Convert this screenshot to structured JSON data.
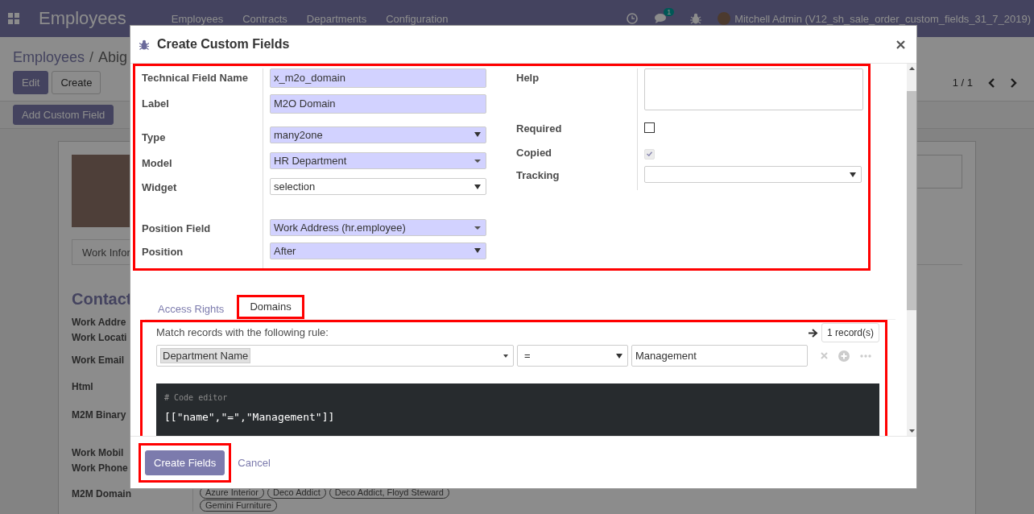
{
  "navbar": {
    "app_title": "Employees",
    "menu": [
      "Employees",
      "Contracts",
      "Departments",
      "Configuration"
    ],
    "chat_count": "1",
    "user": "Mitchell Admin (V12_sh_sale_order_custom_fields_31_7_2019)"
  },
  "control_panel": {
    "breadcrumb": [
      "Employees",
      "Abig"
    ],
    "breadcrumb_separator": "/",
    "buttons": [
      {
        "label": "Edit",
        "kind": "primary"
      },
      {
        "label": "Create",
        "kind": "secondary"
      }
    ],
    "pager": "1 / 1",
    "custom_button": "Add Custom Field"
  },
  "employee_form": {
    "tab": "Work Infor",
    "section_title": "Contact",
    "labels": [
      "Work Addre",
      "Work Locati",
      "Work Email",
      "Html",
      "M2M Binary",
      "Work Mobil",
      "Work Phone"
    ],
    "domain_label": "M2M Domain",
    "tags": [
      "Azure Interior",
      "Deco Addict",
      "Deco Addict, Floyd Steward",
      "Gemini Furniture"
    ]
  },
  "dialog": {
    "title": "Create Custom Fields",
    "fields_panel": {
      "highlighted": true,
      "left": [
        {
          "label": "Technical Field Name",
          "kind": "text",
          "value": "x_m2o_domain",
          "required": true
        },
        {
          "label": "Label",
          "kind": "text",
          "value": "M2O Domain",
          "required": true
        },
        {
          "label": "Type",
          "kind": "select",
          "value": "many2one",
          "required": true
        },
        {
          "label": "Model",
          "kind": "many2one",
          "value": "HR Department",
          "required": true
        },
        {
          "label": "Widget",
          "kind": "select",
          "value": "selection",
          "required": false
        },
        {
          "label": "Position Field",
          "kind": "many2one",
          "value": "Work Address (hr.employee)",
          "required": true
        },
        {
          "label": "Position",
          "kind": "select",
          "value": "After",
          "required": true
        }
      ],
      "right": [
        {
          "label": "Help",
          "kind": "textarea"
        },
        {
          "label": "Required",
          "kind": "checkbox",
          "checked": false,
          "disabled": false
        },
        {
          "label": "Copied",
          "kind": "checkbox",
          "checked": true,
          "disabled": true
        },
        {
          "label": "Tracking",
          "kind": "select"
        }
      ]
    },
    "tabs": [
      {
        "label": "Access Rights",
        "selected": false,
        "highlighted": false
      },
      {
        "label": "Domains",
        "selected": true,
        "highlighted": true
      }
    ],
    "domain": {
      "highlighted": true,
      "intro": "Match records with the following rule:",
      "record_count": "1 record(s)",
      "field": "Department Name",
      "operator": "=",
      "value": "Management",
      "code_comment": "# Code editor",
      "code": "[[\"name\",\"=\",\"Management\"]]"
    },
    "footer": {
      "primary": "Create Fields",
      "primary_highlighted": true,
      "cancel": "Cancel"
    }
  }
}
